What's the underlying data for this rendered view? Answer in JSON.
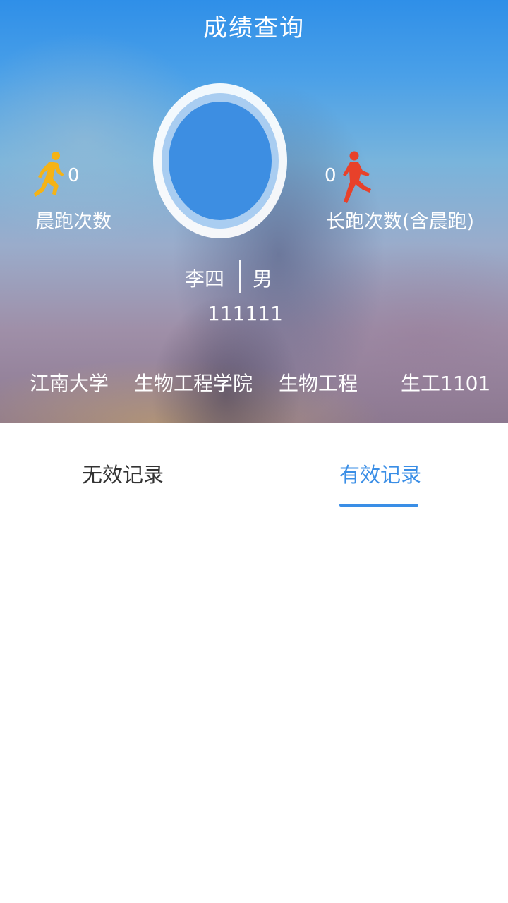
{
  "header": {
    "title": "成绩查询"
  },
  "stats": {
    "morning_run": {
      "count": "0",
      "label": "晨跑次数",
      "icon": "yellow-runner-icon",
      "color": "#f5b316"
    },
    "long_run": {
      "count": "0",
      "label": "长跑次数(含晨跑)",
      "icon": "red-runner-icon",
      "color": "#e8412a"
    }
  },
  "profile": {
    "name": "李四",
    "gender": "男",
    "student_id": "111111",
    "university": "江南大学",
    "college": "生物工程学院",
    "major": "生物工程",
    "class_name": "生工1101"
  },
  "tabs": [
    {
      "label": "无效记录",
      "active": false
    },
    {
      "label": "有效记录",
      "active": true
    }
  ],
  "colors": {
    "accent": "#3a8ee6",
    "header_blue": "#2f8fe8"
  }
}
